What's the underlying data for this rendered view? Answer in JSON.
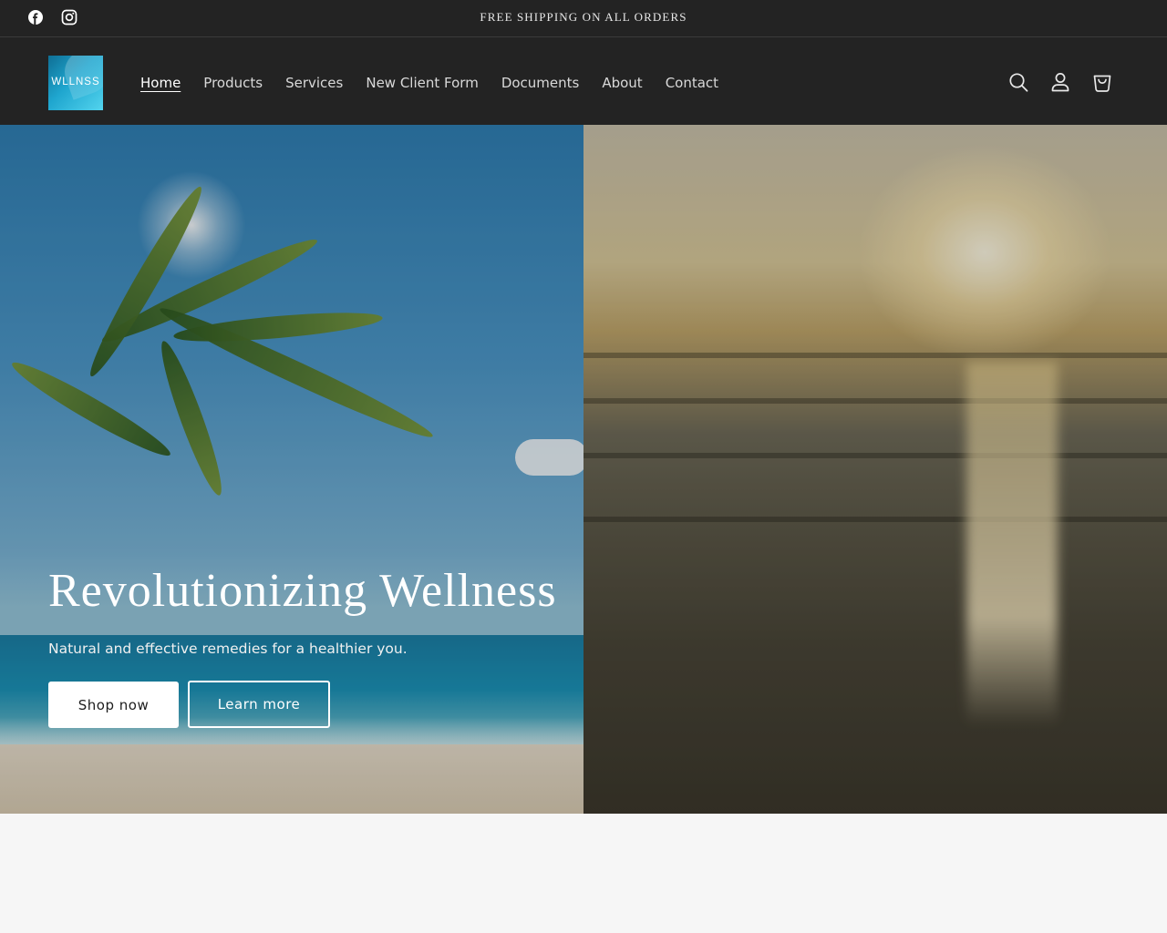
{
  "announcement": {
    "message": "FREE SHIPPING ON ALL ORDERS",
    "social": [
      {
        "name": "facebook-icon"
      },
      {
        "name": "instagram-icon"
      }
    ]
  },
  "header": {
    "logo_text": "WLLNSS",
    "nav": [
      {
        "label": "Home",
        "active": true
      },
      {
        "label": "Products",
        "active": false
      },
      {
        "label": "Services",
        "active": false
      },
      {
        "label": "New Client Form",
        "active": false
      },
      {
        "label": "Documents",
        "active": false
      },
      {
        "label": "About",
        "active": false
      },
      {
        "label": "Contact",
        "active": false
      }
    ],
    "icons": [
      "search-icon",
      "account-icon",
      "cart-icon"
    ]
  },
  "hero": {
    "title": "Revolutionizing Wellness",
    "subtitle": "Natural and effective remedies for a healthier you.",
    "primary_button": "Shop now",
    "secondary_button": "Learn more"
  },
  "colors": {
    "header_bg": "#232323",
    "page_bg": "#f6f6f6",
    "logo_gradient_start": "#0f6f95",
    "logo_gradient_end": "#53d4ee"
  }
}
